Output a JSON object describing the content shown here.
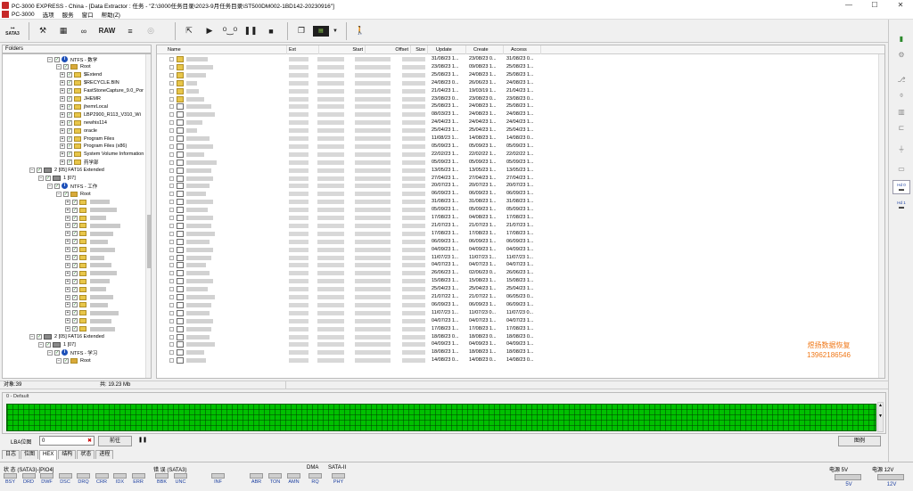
{
  "window": {
    "title": "PC-3000 EXPRESS - China - [Data Extractor : 任务 - \"Z:\\3000任务目录\\2023-9月任务目录\\ST500DM002-1BD142-20230916\"]",
    "minimize": "—",
    "maximize": "☐",
    "close": "✕"
  },
  "menu": [
    "PC-3000",
    "选项",
    "服务",
    "窗口",
    "帮助(Z)"
  ],
  "toolbar": {
    "sata_label": "SATA3",
    "raw_label": "RAW",
    "icons": [
      "sata-port-icon",
      "tools-icon",
      "calculator-icon",
      "binoculars-icon",
      "raw-icon",
      "stack-icon",
      "disk-icon",
      "export-icon",
      "play-icon",
      "bicycle-icon",
      "pause-icon",
      "stop-icon",
      "copy-icon",
      "monitor-icon",
      "dropdown-icon",
      "walker-icon"
    ]
  },
  "folders_panel": {
    "header": "Folders",
    "rows": [
      {
        "label": "NTFS - 数学",
        "kind": "info",
        "depth": 3
      },
      {
        "label": "Root",
        "kind": "root",
        "depth": 4
      },
      {
        "label": "$Extend",
        "kind": "folder",
        "depth": 5
      },
      {
        "label": "$RECYCLE.BIN",
        "kind": "folder",
        "depth": 5
      },
      {
        "label": "FastStoneCapture_9.0_Por",
        "kind": "folder",
        "depth": 5
      },
      {
        "label": "JHEMR",
        "kind": "folder",
        "depth": 5
      },
      {
        "label": "jhemrLocal",
        "kind": "folder",
        "depth": 5
      },
      {
        "label": "LBP2900_R113_V310_Wi",
        "kind": "folder",
        "depth": 5
      },
      {
        "label": "newhis114",
        "kind": "folder",
        "depth": 5
      },
      {
        "label": "oracle",
        "kind": "folder",
        "depth": 5
      },
      {
        "label": "Program Files",
        "kind": "folder",
        "depth": 5
      },
      {
        "label": "Program Files (x86)",
        "kind": "folder",
        "depth": 5
      },
      {
        "label": "System Volume Information",
        "kind": "folder",
        "depth": 5
      },
      {
        "label": "药学部",
        "kind": "folder",
        "depth": 5
      },
      {
        "label": "2 [05] FAT16 Extended",
        "kind": "disk",
        "depth": 1
      },
      {
        "label": "1 [07]",
        "kind": "disk",
        "depth": 2
      },
      {
        "label": "NTFS - 工作",
        "kind": "info",
        "depth": 3
      },
      {
        "label": "Root",
        "kind": "root",
        "depth": 4
      },
      {
        "label": "",
        "kind": "folder-blur",
        "depth": 5
      },
      {
        "label": "",
        "kind": "folder-blur",
        "depth": 5
      },
      {
        "label": "",
        "kind": "folder-blur",
        "depth": 5
      },
      {
        "label": "",
        "kind": "folder-blur",
        "depth": 5
      },
      {
        "label": "",
        "kind": "folder-blur",
        "depth": 5
      },
      {
        "label": "",
        "kind": "folder-blur",
        "depth": 5
      },
      {
        "label": "",
        "kind": "folder-blur",
        "depth": 5
      },
      {
        "label": "",
        "kind": "folder-blur",
        "depth": 5
      },
      {
        "label": "",
        "kind": "folder-blur",
        "depth": 5
      },
      {
        "label": "",
        "kind": "folder-blur",
        "depth": 5
      },
      {
        "label": "",
        "kind": "folder-blur",
        "depth": 5
      },
      {
        "label": "",
        "kind": "folder-blur",
        "depth": 5
      },
      {
        "label": "",
        "kind": "folder-blur",
        "depth": 5
      },
      {
        "label": "",
        "kind": "folder-blur",
        "depth": 5
      },
      {
        "label": "",
        "kind": "folder-blur",
        "depth": 5
      },
      {
        "label": "",
        "kind": "folder-blur",
        "depth": 5
      },
      {
        "label": "",
        "kind": "folder-blur",
        "depth": 5
      },
      {
        "label": "2 [05] FAT16 Extended",
        "kind": "disk",
        "depth": 1
      },
      {
        "label": "1 [07]",
        "kind": "disk",
        "depth": 2
      },
      {
        "label": "NTFS - 学习",
        "kind": "info",
        "depth": 3
      },
      {
        "label": "Root",
        "kind": "root",
        "depth": 4
      }
    ]
  },
  "file_list": {
    "columns": {
      "name": "Name",
      "ext": "Ext",
      "start": "Start",
      "offset": "Offset",
      "size": "Size",
      "update": "Update",
      "create": "Create",
      "access": "Access"
    },
    "rows": [
      {
        "icon": "folder",
        "update": "31/08/23 1...",
        "create": "23/08/23 0...",
        "access": "31/08/23 0..."
      },
      {
        "icon": "folder",
        "update": "23/08/23 1...",
        "create": "09/08/23 1...",
        "access": "25/08/23 1..."
      },
      {
        "icon": "folder",
        "update": "25/08/23 1...",
        "create": "24/08/23 1...",
        "access": "25/08/23 1..."
      },
      {
        "icon": "folder",
        "update": "24/08/23 0...",
        "create": "26/06/23 1...",
        "access": "24/08/23 1..."
      },
      {
        "icon": "folder",
        "update": "21/04/23 1...",
        "create": "19/03/19 1...",
        "access": "21/04/23 1..."
      },
      {
        "icon": "folder",
        "update": "23/08/23 0...",
        "create": "23/08/23 0...",
        "access": "23/08/23 0..."
      },
      {
        "icon": "doc",
        "update": "25/08/23 1...",
        "create": "24/08/23 1...",
        "access": "25/08/23 1..."
      },
      {
        "icon": "doc",
        "update": "08/03/23 1...",
        "create": "24/08/23 1...",
        "access": "24/08/23 1..."
      },
      {
        "icon": "doc",
        "update": "24/04/23 1...",
        "create": "24/04/23 1...",
        "access": "24/04/23 1..."
      },
      {
        "icon": "doc",
        "update": "25/04/23 1...",
        "create": "25/04/23 1...",
        "access": "25/04/23 1..."
      },
      {
        "icon": "doc",
        "update": "11/08/23 1...",
        "create": "14/08/23 1...",
        "access": "14/08/23 0..."
      },
      {
        "icon": "doc",
        "update": "05/09/23 1...",
        "create": "05/09/23 1...",
        "access": "05/09/23 1..."
      },
      {
        "icon": "doc",
        "update": "22/02/23 1...",
        "create": "22/02/22 1...",
        "access": "22/02/22 1..."
      },
      {
        "icon": "doc",
        "update": "05/09/23 1...",
        "create": "05/09/23 1...",
        "access": "05/09/23 1..."
      },
      {
        "icon": "doc",
        "update": "13/05/23 1...",
        "create": "13/05/23 1...",
        "access": "13/05/23 1..."
      },
      {
        "icon": "doc",
        "update": "27/04/23 1...",
        "create": "27/04/23 1...",
        "access": "27/04/23 1..."
      },
      {
        "icon": "doc",
        "update": "20/07/23 1...",
        "create": "20/07/23 1...",
        "access": "20/07/23 1..."
      },
      {
        "icon": "doc",
        "update": "06/09/23 1...",
        "create": "06/09/23 1...",
        "access": "06/09/23 1..."
      },
      {
        "icon": "doc",
        "update": "31/08/23 1...",
        "create": "31/08/23 1...",
        "access": "31/08/23 1..."
      },
      {
        "icon": "doc",
        "update": "05/09/23 1...",
        "create": "05/09/23 1...",
        "access": "05/09/23 1..."
      },
      {
        "icon": "doc",
        "update": "17/08/23 1...",
        "create": "04/08/23 1...",
        "access": "17/08/23 1..."
      },
      {
        "icon": "doc",
        "update": "21/07/23 1...",
        "create": "21/07/23 1...",
        "access": "21/07/23 1..."
      },
      {
        "icon": "doc",
        "update": "17/08/23 1...",
        "create": "17/08/23 1...",
        "access": "17/08/23 1..."
      },
      {
        "icon": "doc",
        "update": "06/09/23 1...",
        "create": "06/09/23 1...",
        "access": "06/09/23 1..."
      },
      {
        "icon": "doc",
        "update": "04/09/23 1...",
        "create": "04/09/23 1...",
        "access": "04/09/23 1..."
      },
      {
        "icon": "doc",
        "update": "11/07/23 1...",
        "create": "11/07/23 1...",
        "access": "11/07/23 1..."
      },
      {
        "icon": "doc",
        "update": "04/07/23 1...",
        "create": "04/07/23 1...",
        "access": "04/07/23 1..."
      },
      {
        "icon": "doc",
        "update": "26/06/23 1...",
        "create": "02/06/23 0...",
        "access": "26/06/23 1..."
      },
      {
        "icon": "doc",
        "update": "15/08/23 1...",
        "create": "15/08/23 1...",
        "access": "15/08/23 1..."
      },
      {
        "icon": "doc",
        "update": "25/04/23 1...",
        "create": "25/04/23 1...",
        "access": "25/04/23 1..."
      },
      {
        "icon": "doc",
        "update": "21/07/22 1...",
        "create": "21/07/22 1...",
        "access": "06/05/23 0..."
      },
      {
        "icon": "doc",
        "update": "06/09/23 1...",
        "create": "06/09/23 1...",
        "access": "06/09/23 1..."
      },
      {
        "icon": "doc",
        "update": "11/07/23 1...",
        "create": "11/07/23 0...",
        "access": "11/07/23 0..."
      },
      {
        "icon": "doc",
        "update": "04/07/23 1...",
        "create": "04/07/23 1...",
        "access": "04/07/23 1..."
      },
      {
        "icon": "doc",
        "update": "17/08/23 1...",
        "create": "17/08/23 1...",
        "access": "17/08/23 1..."
      },
      {
        "icon": "doc",
        "update": "18/08/23 0...",
        "create": "18/08/23 0...",
        "access": "18/08/23 0..."
      },
      {
        "icon": "doc",
        "update": "04/09/23 1...",
        "create": "04/09/23 1...",
        "access": "04/09/23 1..."
      },
      {
        "icon": "doc",
        "update": "18/08/23 1...",
        "create": "18/08/23 1...",
        "access": "18/08/23 1..."
      },
      {
        "icon": "doc",
        "update": "14/08/23 0...",
        "create": "14/08/23 0...",
        "access": "14/08/23 0..."
      }
    ]
  },
  "watermark": {
    "line1": "煜扬数据恢复",
    "line2": "13962186546"
  },
  "status_line": {
    "objects": "对象:39",
    "total": "共: 19.23 Mb"
  },
  "sector_map": {
    "title": "0 - Default"
  },
  "lba_bar": {
    "label": "LBA位图",
    "value": "0",
    "goto_button": "前往",
    "pause_icon": "pause-icon",
    "legend_button": "图例"
  },
  "tabs": [
    {
      "label": "日志",
      "active": false
    },
    {
      "label": "位图",
      "active": false
    },
    {
      "label": "HEX",
      "active": true
    },
    {
      "label": "结构",
      "active": false
    },
    {
      "label": "状态",
      "active": false
    },
    {
      "label": "进程",
      "active": false
    }
  ],
  "bottom_status": {
    "status_group": {
      "title": "状 态 (SATA3)-[PIO4]",
      "lamps": [
        "BSY",
        "DRD",
        "DWF",
        "DSC",
        "DRQ",
        "CRR",
        "IDX",
        "ERR"
      ]
    },
    "error_group": {
      "title": "错 误 (SATA3)",
      "lamps": [
        "BBK",
        "UNC",
        "INF",
        "ABR",
        "TON",
        "AMN"
      ]
    },
    "dma_group": {
      "title": "DMA",
      "lamps": [
        "RQ"
      ]
    },
    "sata_group": {
      "title": "SATA-II",
      "lamps": [
        "PHY"
      ]
    },
    "power5": {
      "title": "电源 5V",
      "value": "5V"
    },
    "power12": {
      "title": "电源 12V",
      "value": "12V"
    }
  },
  "right_strip": {
    "hd_label_1": "Hd 0",
    "hd_label_2": "Hd 1"
  }
}
